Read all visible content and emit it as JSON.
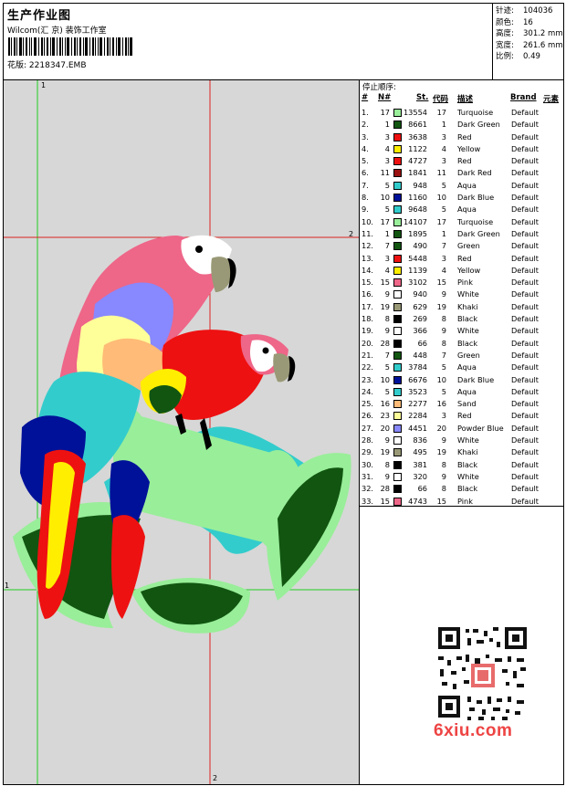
{
  "header": {
    "title": "生产作业图",
    "subtitle": "Wilcom(汇 京) 装饰工作室",
    "pattern_label": "花版:",
    "pattern_value": "2218347.EMB"
  },
  "meta": [
    {
      "label": "针迹:",
      "value": "104036"
    },
    {
      "label": "颜色:",
      "value": "16"
    },
    {
      "label": "高度:",
      "value": "301.2 mm"
    },
    {
      "label": "宽度:",
      "value": "261.6 mm"
    },
    {
      "label": "比例:",
      "value": "0.49"
    }
  ],
  "canvas": {
    "marker_top": "1",
    "marker_right": "2",
    "marker_bottom": "2",
    "marker_left": "1",
    "background": "#d7d7d7",
    "guide_color": "#22cc22",
    "guide2_color": "#dd2222"
  },
  "stops": {
    "caption": "停止顺序:",
    "headers": {
      "idx": "#",
      "no": "N#",
      "st": "St.",
      "code": "代码",
      "desc": "描述",
      "brand": "Brand",
      "elem": "元素"
    },
    "rows": [
      {
        "idx": "1.",
        "no": "17",
        "color": "#99ee99",
        "st": "13554",
        "code": "17",
        "desc": "Turquoise",
        "brand": "Default"
      },
      {
        "idx": "2.",
        "no": "1",
        "color": "#115511",
        "st": "8661",
        "code": "1",
        "desc": "Dark Green",
        "brand": "Default"
      },
      {
        "idx": "3.",
        "no": "3",
        "color": "#ee1111",
        "st": "3638",
        "code": "3",
        "desc": "Red",
        "brand": "Default"
      },
      {
        "idx": "4.",
        "no": "4",
        "color": "#ffee00",
        "st": "1122",
        "code": "4",
        "desc": "Yellow",
        "brand": "Default"
      },
      {
        "idx": "5.",
        "no": "3",
        "color": "#ee1111",
        "st": "4727",
        "code": "3",
        "desc": "Red",
        "brand": "Default"
      },
      {
        "idx": "6.",
        "no": "11",
        "color": "#991111",
        "st": "1841",
        "code": "11",
        "desc": "Dark Red",
        "brand": "Default"
      },
      {
        "idx": "7.",
        "no": "5",
        "color": "#33cccc",
        "st": "948",
        "code": "5",
        "desc": "Aqua",
        "brand": "Default"
      },
      {
        "idx": "8.",
        "no": "10",
        "color": "#001199",
        "st": "1160",
        "code": "10",
        "desc": "Dark Blue",
        "brand": "Default"
      },
      {
        "idx": "9.",
        "no": "5",
        "color": "#33cccc",
        "st": "9648",
        "code": "5",
        "desc": "Aqua",
        "brand": "Default"
      },
      {
        "idx": "10.",
        "no": "17",
        "color": "#99ee99",
        "st": "14107",
        "code": "17",
        "desc": "Turquoise",
        "brand": "Default"
      },
      {
        "idx": "11.",
        "no": "1",
        "color": "#115511",
        "st": "1895",
        "code": "1",
        "desc": "Dark Green",
        "brand": "Default"
      },
      {
        "idx": "12.",
        "no": "7",
        "color": "#115511",
        "st": "490",
        "code": "7",
        "desc": "Green",
        "brand": "Default"
      },
      {
        "idx": "13.",
        "no": "3",
        "color": "#ee1111",
        "st": "5448",
        "code": "3",
        "desc": "Red",
        "brand": "Default"
      },
      {
        "idx": "14.",
        "no": "4",
        "color": "#ffee00",
        "st": "1139",
        "code": "4",
        "desc": "Yellow",
        "brand": "Default"
      },
      {
        "idx": "15.",
        "no": "15",
        "color": "#ee6688",
        "st": "3102",
        "code": "15",
        "desc": "Pink",
        "brand": "Default"
      },
      {
        "idx": "16.",
        "no": "9",
        "color": "#ffffff",
        "st": "940",
        "code": "9",
        "desc": "White",
        "brand": "Default"
      },
      {
        "idx": "17.",
        "no": "19",
        "color": "#999977",
        "st": "629",
        "code": "19",
        "desc": "Khaki",
        "brand": "Default"
      },
      {
        "idx": "18.",
        "no": "8",
        "color": "#000000",
        "st": "269",
        "code": "8",
        "desc": "Black",
        "brand": "Default"
      },
      {
        "idx": "19.",
        "no": "9",
        "color": "#ffffff",
        "st": "366",
        "code": "9",
        "desc": "White",
        "brand": "Default"
      },
      {
        "idx": "20.",
        "no": "28",
        "color": "#000000",
        "st": "66",
        "code": "8",
        "desc": "Black",
        "brand": "Default"
      },
      {
        "idx": "21.",
        "no": "7",
        "color": "#115511",
        "st": "448",
        "code": "7",
        "desc": "Green",
        "brand": "Default"
      },
      {
        "idx": "22.",
        "no": "5",
        "color": "#33cccc",
        "st": "3784",
        "code": "5",
        "desc": "Aqua",
        "brand": "Default"
      },
      {
        "idx": "23.",
        "no": "10",
        "color": "#001199",
        "st": "6676",
        "code": "10",
        "desc": "Dark Blue",
        "brand": "Default"
      },
      {
        "idx": "24.",
        "no": "5",
        "color": "#33cccc",
        "st": "3523",
        "code": "5",
        "desc": "Aqua",
        "brand": "Default"
      },
      {
        "idx": "25.",
        "no": "16",
        "color": "#ffbb77",
        "st": "2277",
        "code": "16",
        "desc": "Sand",
        "brand": "Default"
      },
      {
        "idx": "26.",
        "no": "23",
        "color": "#ffff99",
        "st": "2284",
        "code": "3",
        "desc": "Red",
        "brand": "Default"
      },
      {
        "idx": "27.",
        "no": "20",
        "color": "#8888ff",
        "st": "4451",
        "code": "20",
        "desc": "Powder Blue",
        "brand": "Default"
      },
      {
        "idx": "28.",
        "no": "9",
        "color": "#ffffff",
        "st": "836",
        "code": "9",
        "desc": "White",
        "brand": "Default"
      },
      {
        "idx": "29.",
        "no": "19",
        "color": "#999977",
        "st": "495",
        "code": "19",
        "desc": "Khaki",
        "brand": "Default"
      },
      {
        "idx": "30.",
        "no": "8",
        "color": "#000000",
        "st": "381",
        "code": "8",
        "desc": "Black",
        "brand": "Default"
      },
      {
        "idx": "31.",
        "no": "9",
        "color": "#ffffff",
        "st": "320",
        "code": "9",
        "desc": "White",
        "brand": "Default"
      },
      {
        "idx": "32.",
        "no": "28",
        "color": "#000000",
        "st": "66",
        "code": "8",
        "desc": "Black",
        "brand": "Default"
      },
      {
        "idx": "33.",
        "no": "15",
        "color": "#ee6688",
        "st": "4743",
        "code": "15",
        "desc": "Pink",
        "brand": "Default"
      }
    ]
  },
  "watermark": {
    "text": "6xiu.com",
    "color": "#e44444"
  }
}
